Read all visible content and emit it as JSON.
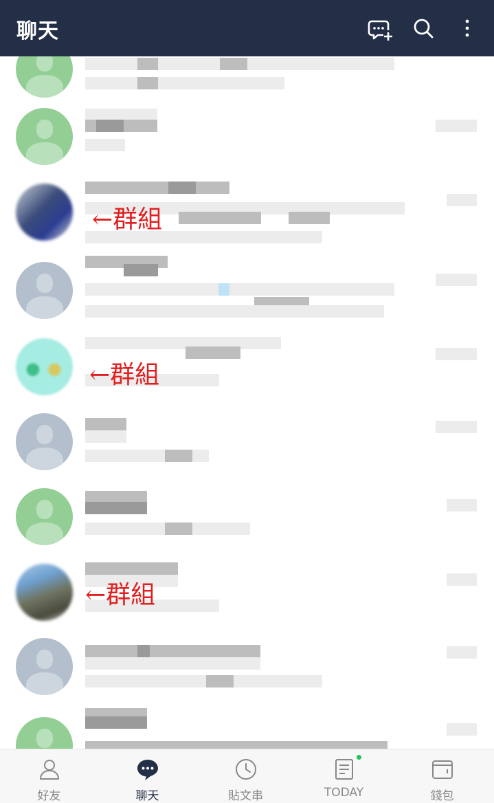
{
  "header": {
    "title": "聊天",
    "icons": [
      "new-chat-icon",
      "search-icon",
      "more-vertical-icon"
    ]
  },
  "chat_list": {
    "annotations": [
      "←群組",
      "←群組",
      "←群組"
    ]
  },
  "bottom_nav": {
    "items": [
      {
        "label": "好友",
        "icon": "friends-icon",
        "active": false
      },
      {
        "label": "聊天",
        "icon": "chat-icon",
        "active": true
      },
      {
        "label": "貼文串",
        "icon": "timeline-icon",
        "active": false
      },
      {
        "label": "TODAY",
        "icon": "today-icon",
        "active": false,
        "badge_dot": true
      },
      {
        "label": "錢包",
        "icon": "wallet-icon",
        "active": false
      }
    ]
  },
  "colors": {
    "header_bg": "#232e47",
    "annotation": "#e02020",
    "badge_dot": "#25c35b"
  }
}
